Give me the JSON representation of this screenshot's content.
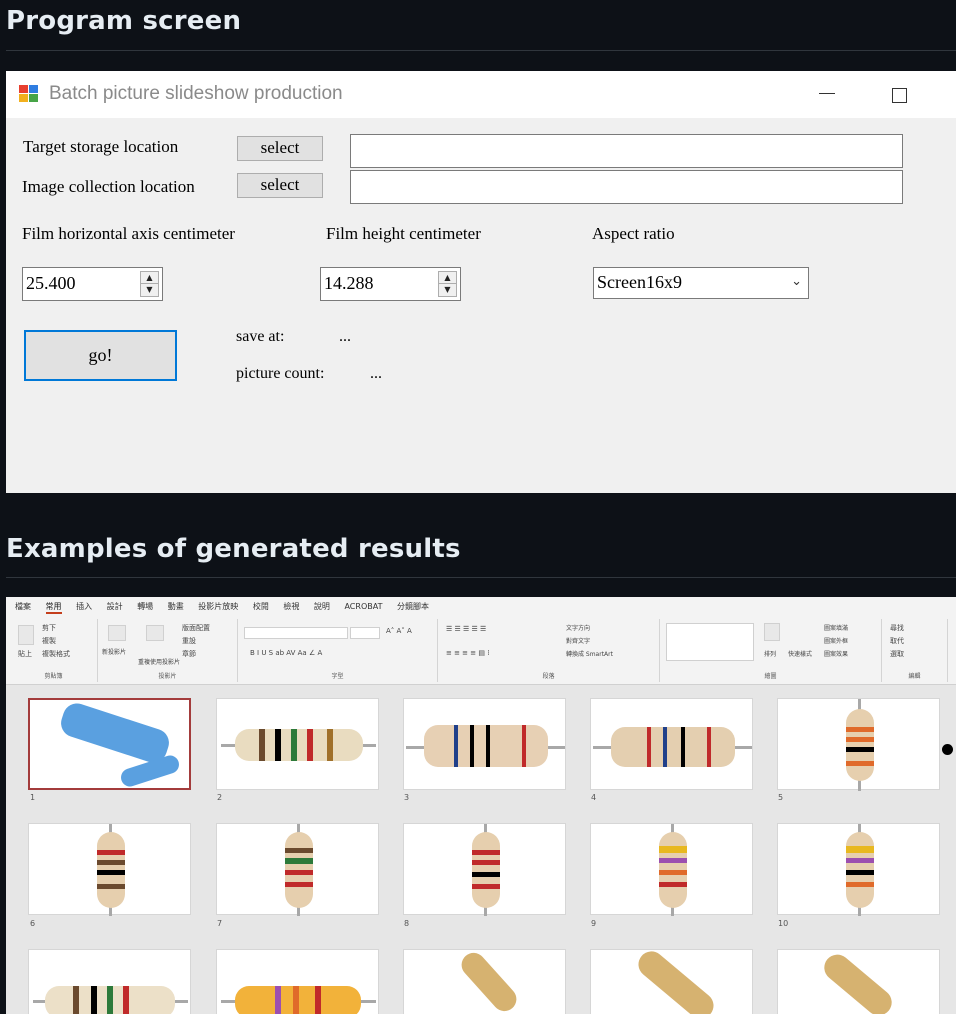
{
  "sections": {
    "program_screen": "Program screen",
    "examples": "Examples of generated results"
  },
  "window": {
    "title": "Batch picture slideshow production",
    "target_label": "Target storage location",
    "target_select": "select",
    "target_value": "",
    "image_label": "Image collection location",
    "image_select": "select",
    "image_value": "",
    "width_label": "Film horizontal axis centimeter",
    "width_value": "25.400",
    "height_label": "Film height centimeter",
    "height_value": "14.288",
    "aspect_label": "Aspect ratio",
    "aspect_value": "Screen16x9",
    "go_label": "go!",
    "save_at_label": "save at:",
    "save_at_value": "...",
    "count_label": "picture count:",
    "count_value": "..."
  },
  "ppt": {
    "tabs": [
      "檔案",
      "常用",
      "插入",
      "設計",
      "轉場",
      "動畫",
      "投影片放映",
      "校閱",
      "檢視",
      "說明",
      "ACROBAT",
      "分鏡腳本"
    ],
    "active_tab": "常用",
    "groups": {
      "clipboard": "剪貼簿",
      "slides": "投影片",
      "font": "字型",
      "paragraph": "段落",
      "drawing": "繪圖",
      "editing": "編輯"
    },
    "buttons": {
      "paste": "貼上",
      "cut": "剪下",
      "copy": "複製",
      "format_painter": "複製格式",
      "new_slide": "新投影片",
      "reuse": "重複使用投影片",
      "layout": "版面配置",
      "reset": "重設",
      "section": "章節",
      "text_direction": "文字方向",
      "align_text": "對齊文字",
      "smartart": "轉換成 SmartArt",
      "arrange": "排列",
      "quick_styles": "快速樣式",
      "shape_fill": "圖案填滿",
      "shape_outline": "圖案外框",
      "shape_effects": "圖案效果",
      "find": "尋找",
      "replace": "取代",
      "select": "選取"
    },
    "slide_numbers": [
      "1",
      "2",
      "3",
      "4",
      "5",
      "6",
      "7",
      "8",
      "9",
      "10"
    ]
  }
}
